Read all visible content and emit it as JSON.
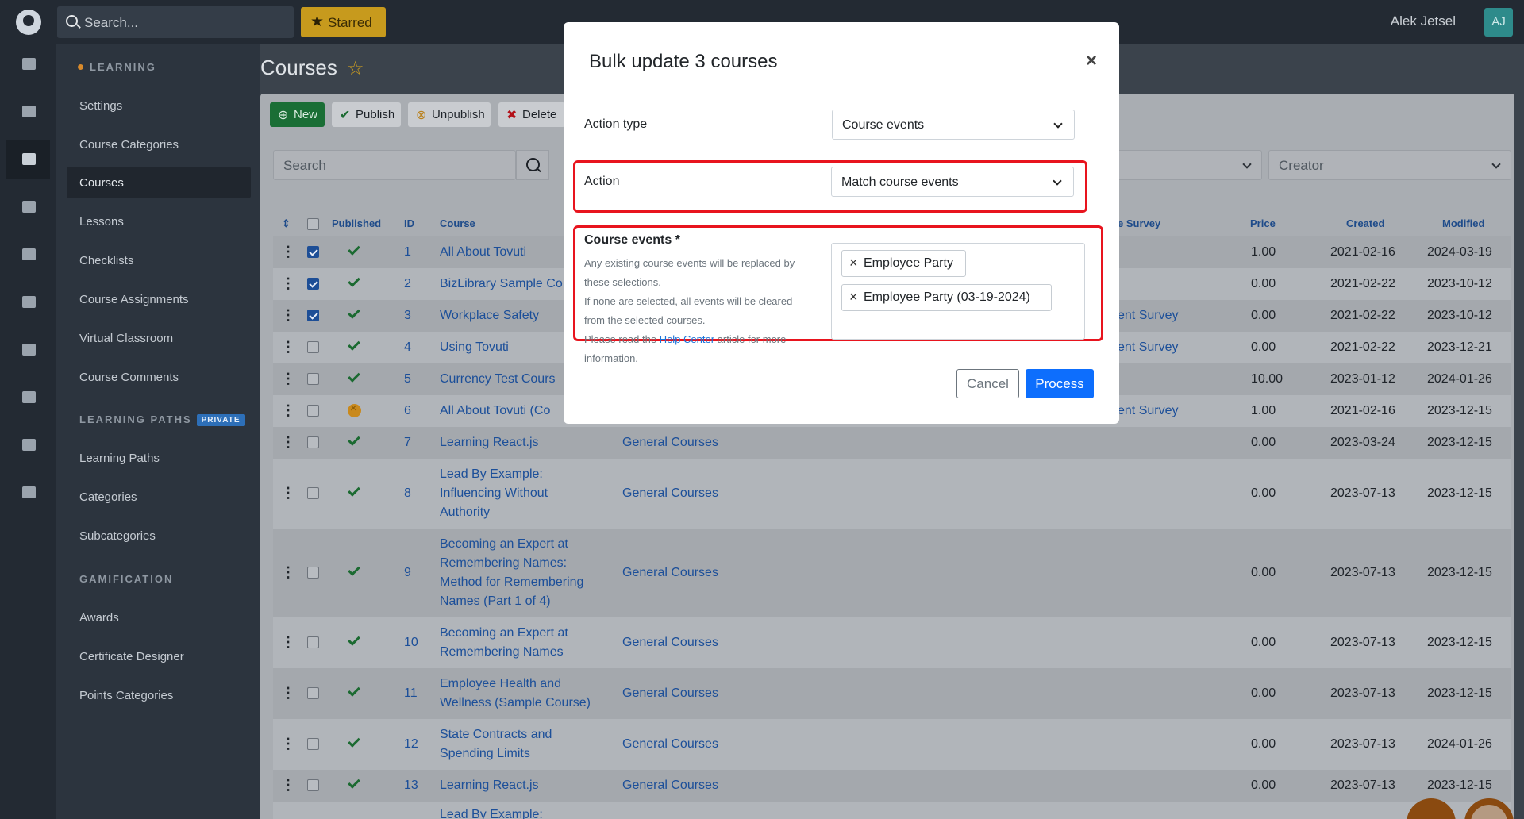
{
  "topbar": {
    "search_placeholder": "Search...",
    "starred_label": "Starred",
    "user_name": "Alek Jetsel",
    "user_initials": "AJ"
  },
  "rail": {
    "icons": [
      "users-icon",
      "pets-icon",
      "graduation-cap-icon",
      "megaphone-icon",
      "money-icon",
      "chart-icon",
      "chat-icon",
      "palette-icon",
      "calendar-icon",
      "gear-icon"
    ]
  },
  "sidebar": {
    "learning_heading": "LEARNING",
    "learning_items": [
      "Settings",
      "Course Categories",
      "Courses",
      "Lessons",
      "Checklists",
      "Course Assignments",
      "Virtual Classroom",
      "Course Comments"
    ],
    "paths_heading": "LEARNING PATHS",
    "paths_badge": "PRIVATE",
    "paths_items": [
      "Learning Paths",
      "Categories",
      "Subcategories"
    ],
    "gamification_heading": "GAMIFICATION",
    "gamification_items": [
      "Awards",
      "Certificate Designer",
      "Points Categories"
    ]
  },
  "page": {
    "title": "Courses"
  },
  "toolbar": {
    "new_label": "New",
    "publish_label": "Publish",
    "unpublish_label": "Unpublish",
    "delete_label": "Delete"
  },
  "filters": {
    "search_placeholder": "Search",
    "creator_placeholder": "Creator"
  },
  "table": {
    "headers": {
      "published": "Published",
      "id": "ID",
      "course": "Course",
      "survey": "e Survey",
      "price": "Price",
      "created": "Created",
      "modified": "Modified"
    },
    "rows": [
      {
        "id": "1",
        "course": "All About Tovuti",
        "category": "",
        "survey": "",
        "price": "1.00",
        "created": "2021-02-16",
        "modified": "2024-03-19",
        "checked": true,
        "status": "published"
      },
      {
        "id": "2",
        "course": "BizLibrary Sample Co",
        "category": "",
        "survey": "",
        "price": "0.00",
        "created": "2021-02-22",
        "modified": "2023-10-12",
        "checked": true,
        "status": "published"
      },
      {
        "id": "3",
        "course": "Workplace Safety",
        "category": "",
        "survey": "ent Survey",
        "price": "0.00",
        "created": "2021-02-22",
        "modified": "2023-10-12",
        "checked": true,
        "status": "published"
      },
      {
        "id": "4",
        "course": "Using Tovuti",
        "category": "",
        "survey": "ent Survey",
        "price": "0.00",
        "created": "2021-02-22",
        "modified": "2023-12-21",
        "checked": false,
        "status": "published"
      },
      {
        "id": "5",
        "course": "Currency Test Cours",
        "category": "",
        "survey": "",
        "price": "10.00",
        "created": "2023-01-12",
        "modified": "2024-01-26",
        "checked": false,
        "status": "published"
      },
      {
        "id": "6",
        "course": "All About Tovuti (Co",
        "category": "",
        "survey": "ent Survey",
        "price": "1.00",
        "created": "2021-02-16",
        "modified": "2023-12-15",
        "checked": false,
        "status": "unpublished"
      },
      {
        "id": "7",
        "course": "Learning React.js",
        "category": "General Courses",
        "survey": "",
        "price": "0.00",
        "created": "2023-03-24",
        "modified": "2023-12-15",
        "checked": false,
        "status": "published"
      },
      {
        "id": "8",
        "course": [
          "Lead By Example:",
          "Influencing Without",
          "Authority"
        ],
        "category": "General Courses",
        "survey": "",
        "price": "0.00",
        "created": "2023-07-13",
        "modified": "2023-12-15",
        "checked": false,
        "status": "published"
      },
      {
        "id": "9",
        "course": [
          "Becoming an Expert at",
          "Remembering Names:",
          "Method for Remembering",
          "Names (Part 1 of 4)"
        ],
        "category": "General Courses",
        "survey": "",
        "price": "0.00",
        "created": "2023-07-13",
        "modified": "2023-12-15",
        "checked": false,
        "status": "published"
      },
      {
        "id": "10",
        "course": [
          "Becoming an Expert at",
          "Remembering Names"
        ],
        "category": "General Courses",
        "survey": "",
        "price": "0.00",
        "created": "2023-07-13",
        "modified": "2023-12-15",
        "checked": false,
        "status": "published"
      },
      {
        "id": "11",
        "course": [
          "Employee Health and",
          "Wellness (Sample Course)"
        ],
        "category": "General Courses",
        "survey": "",
        "price": "0.00",
        "created": "2023-07-13",
        "modified": "2023-12-15",
        "checked": false,
        "status": "published"
      },
      {
        "id": "12",
        "course": [
          "State Contracts and",
          "Spending Limits"
        ],
        "category": "General Courses",
        "survey": "",
        "price": "0.00",
        "created": "2023-07-13",
        "modified": "2024-01-26",
        "checked": false,
        "status": "published"
      },
      {
        "id": "13",
        "course": "Learning React.js",
        "category": "General Courses",
        "survey": "",
        "price": "0.00",
        "created": "2023-07-13",
        "modified": "2023-12-15",
        "checked": false,
        "status": "published"
      },
      {
        "id": "",
        "course": "Lead By Example:",
        "category": "",
        "survey": "",
        "price": "",
        "created": "",
        "modified": "",
        "checked": false,
        "status": "none"
      }
    ]
  },
  "modal": {
    "title": "Bulk update 3 courses",
    "close_label": "×",
    "action_type_label": "Action type",
    "action_type_value": "Course events",
    "action_label": "Action",
    "action_value": "Match course events",
    "events_label": "Course events *",
    "help_line1": "Any existing course events will be replaced by",
    "help_line2": "these selections.",
    "help_line3": "If none are selected, all events will be cleared",
    "help_line4": "from the selected courses.",
    "help_line5_pre": "Please read the ",
    "help_link": "Help Center",
    "help_line5_post": " article for more",
    "help_line6": "information.",
    "tags": [
      "Employee Party",
      "Employee Party (03-19-2024)"
    ],
    "cancel_label": "Cancel",
    "process_label": "Process"
  }
}
